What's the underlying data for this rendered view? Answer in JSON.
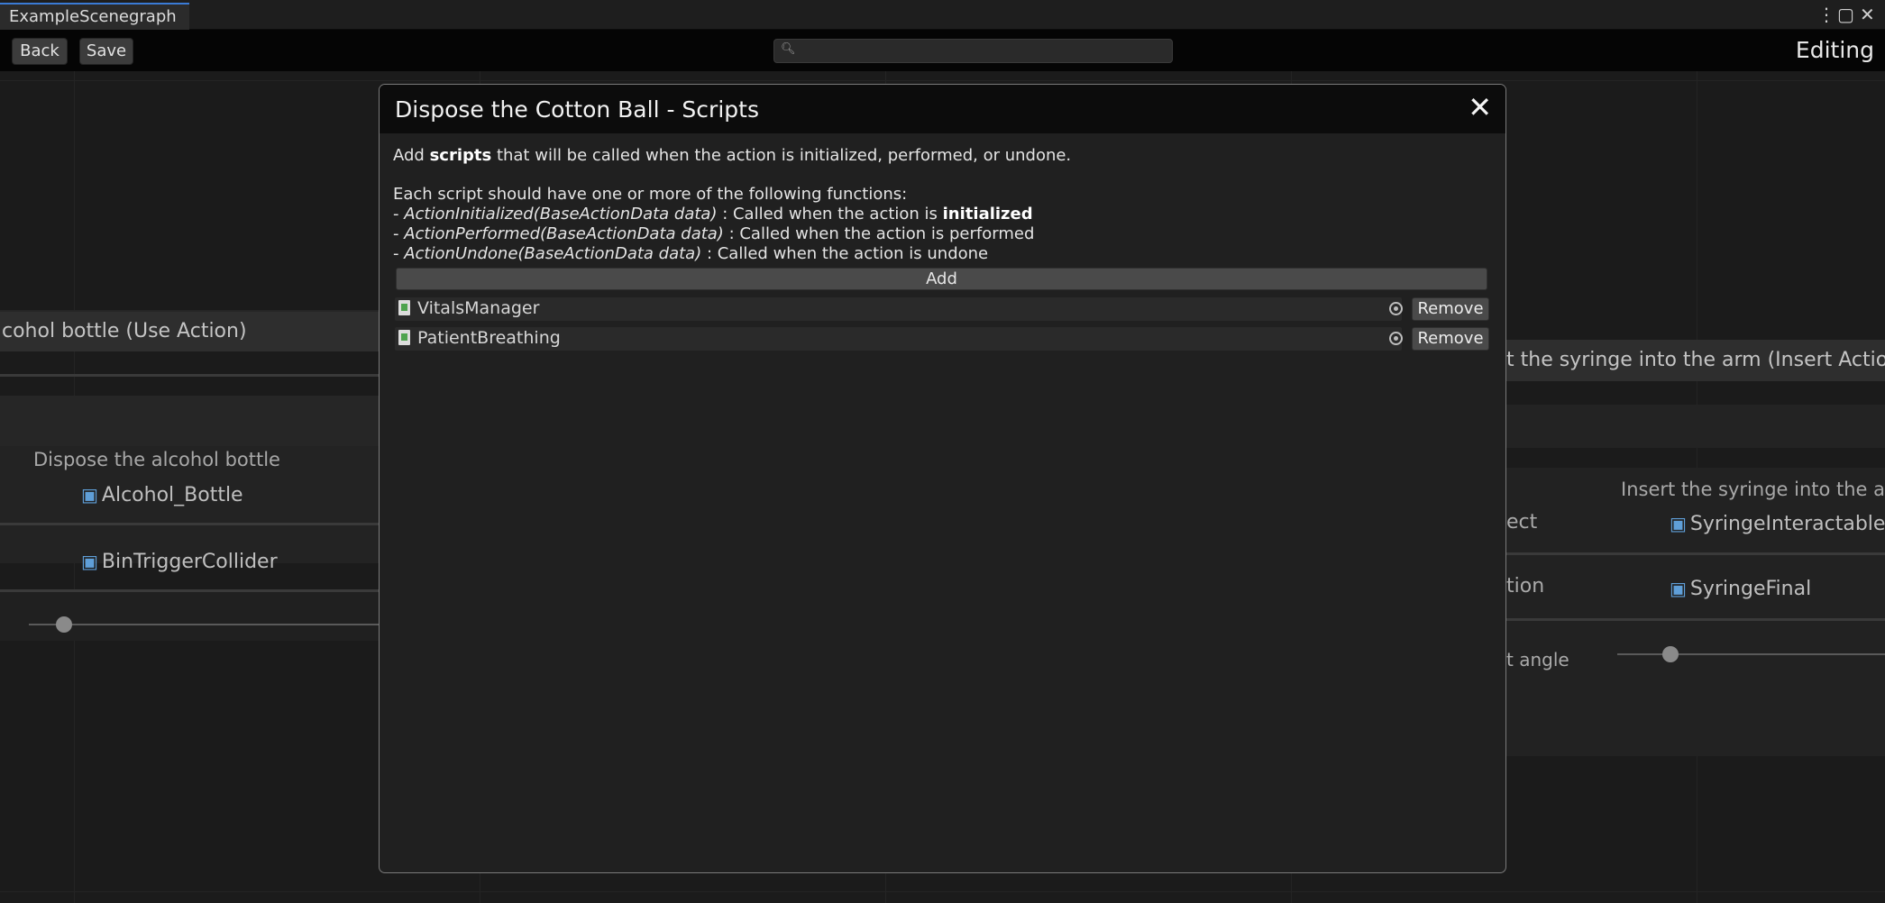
{
  "window": {
    "tab_title": "ExampleScenegraph",
    "controls": {
      "more": "⋮",
      "maximize": "▢",
      "close": "✕"
    }
  },
  "toolbar": {
    "back_label": "Back",
    "save_label": "Save",
    "search": {
      "value": "",
      "placeholder": ""
    },
    "mode_label": "Editing"
  },
  "canvas": {
    "left_node": {
      "header": "cohol bottle (Use Action)",
      "subtitle": "Dispose the alcohol bottle",
      "object_field_1": "Alcohol_Bottle",
      "object_field_2": "BinTriggerCollider",
      "slider_value": 0.1
    },
    "right_node": {
      "header": "t the syringe into the arm (Insert Action)",
      "subtitle": "Insert the syringe into the arm",
      "label_1": "ect",
      "object_field_1": "SyringeInteractable",
      "label_2": "tion",
      "object_field_2": "SyringeFinal",
      "label_3": "t angle",
      "slider_value": 0.2
    }
  },
  "modal": {
    "title": "Dispose the Cotton Ball - Scripts",
    "close_glyph": "✕",
    "intro": {
      "prefix": "Add ",
      "bold": "scripts",
      "suffix": " that will be called when the action is initialized, performed, or undone."
    },
    "functions_heading": "Each script should have one or more of the following functions:",
    "functions": [
      {
        "dash": "- ",
        "signature": "ActionInitialized(BaseActionData data)",
        "desc": " : Called when the action is ",
        "bold": "initialized"
      },
      {
        "dash": "- ",
        "signature": "ActionPerformed(BaseActionData data)",
        "desc": " : Called when the action is performed",
        "bold": ""
      },
      {
        "dash": "- ",
        "signature": "ActionUndone(BaseActionData data)",
        "desc": " : Called when the action is undone",
        "bold": ""
      }
    ],
    "add_label": "Add",
    "scripts": [
      {
        "name": "VitalsManager",
        "remove_label": "Remove"
      },
      {
        "name": "PatientBreathing",
        "remove_label": "Remove"
      }
    ]
  },
  "colors": {
    "accent": "#3a7bd5",
    "cube_icon": "#5f9fd8",
    "script_icon_green": "#4ea34e"
  }
}
